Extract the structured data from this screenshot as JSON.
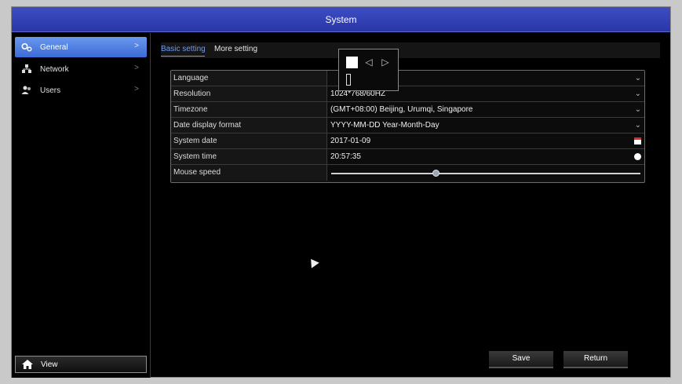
{
  "window": {
    "title": "System"
  },
  "sidebar": {
    "items": [
      {
        "label": "General",
        "icon": "gears-icon",
        "active": true
      },
      {
        "label": "Network",
        "icon": "network-icon",
        "active": false
      },
      {
        "label": "Users",
        "icon": "users-icon",
        "active": false
      }
    ],
    "chevron": ">",
    "view_button": {
      "label": "View",
      "icon": "home-icon"
    }
  },
  "tabs": [
    {
      "label": "Basic setting",
      "active": true
    },
    {
      "label": "More setting",
      "active": false
    }
  ],
  "settings": {
    "language": {
      "label": "Language",
      "value": ""
    },
    "resolution": {
      "label": "Resolution",
      "value": "1024*768/60HZ"
    },
    "timezone": {
      "label": "Timezone",
      "value": "(GMT+08:00) Beijing, Urumqi, Singapore"
    },
    "date_format": {
      "label": "Date display format",
      "value": "YYYY-MM-DD Year-Month-Day"
    },
    "system_date": {
      "label": "System date",
      "value": "2017-01-09"
    },
    "system_time": {
      "label": "System time",
      "value": "20:57:35"
    },
    "mouse_speed": {
      "label": "Mouse speed",
      "value_fraction": 0.34
    }
  },
  "glyphs": {
    "dropdown": "⌄",
    "prev": "◁",
    "next": "▷"
  },
  "buttons": {
    "save": "Save",
    "return": "Return"
  },
  "colors": {
    "titlebar": "#2f3db3",
    "active_tab": "#6f9af0",
    "sidebar_active": "#4a7ae0"
  }
}
